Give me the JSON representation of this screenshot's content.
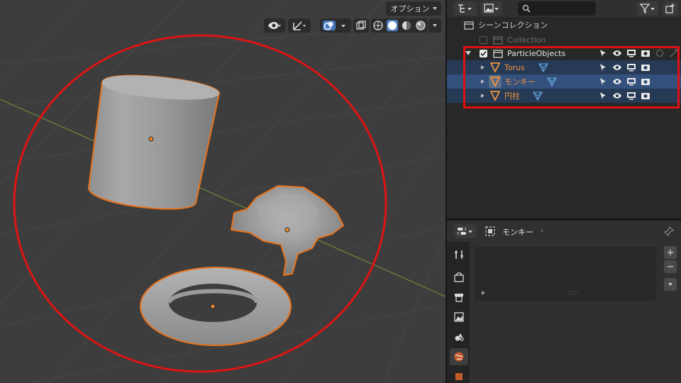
{
  "viewport": {
    "options_label": "オプション",
    "annotation_color": "#dd1414",
    "selection_color": "#e8721c",
    "background_color": "#3d3d3d",
    "icons": [
      "eye-view-icon",
      "gizmo-icon",
      "overlay-icon",
      "xray-icon",
      "shading-wireframe-icon",
      "shading-solid-icon",
      "shading-material-icon",
      "shading-rendered-icon"
    ]
  },
  "outliner": {
    "search_placeholder": "",
    "scene_collection": "シーンコレクション",
    "rows": [
      {
        "name": "Collection",
        "type": "collection",
        "state": "excluded"
      },
      {
        "name": "ParticleObjects",
        "type": "collection",
        "state": "included"
      },
      {
        "name": "Torus",
        "type": "mesh",
        "state": "selected"
      },
      {
        "name": "モンキー",
        "type": "mesh",
        "state": "active"
      },
      {
        "name": "円柱",
        "type": "mesh",
        "state": "selected"
      }
    ],
    "highlight_color": "#e01010"
  },
  "properties": {
    "context_label": "モンキー",
    "add_label": "+",
    "remove_label": "−",
    "tab_icons": [
      "tool-icon",
      "render-icon",
      "output-icon",
      "view-layer-icon",
      "scene-icon",
      "world-icon"
    ]
  }
}
